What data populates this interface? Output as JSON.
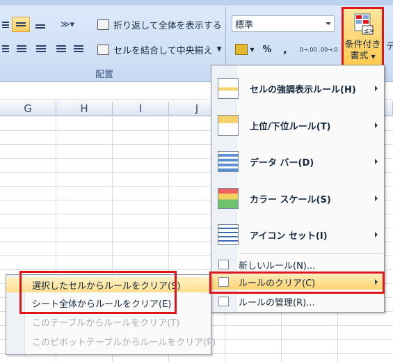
{
  "ribbon": {
    "wrap_text_label": "折り返して全体を表示する",
    "merge_center_label": "セルを結合して中央揃え",
    "group_label": "配置",
    "number_format_value": "標準",
    "percent_label": "%",
    "comma_label": ",",
    "inc_decimal_label": ".0→.00",
    "dec_decimal_label": ".00→.0",
    "conditional_format_label_line1": "条件付き",
    "conditional_format_label_line2": "書式",
    "next_button_partial": "テ"
  },
  "columns": [
    "G",
    "H",
    "I",
    "J"
  ],
  "menu": {
    "items": [
      {
        "label": "セルの強調表示ルール(H)",
        "icon": "highlight-rules-icon",
        "has_submenu": true
      },
      {
        "label": "上位/下位ルール(T)",
        "icon": "top-bottom-rules-icon",
        "has_submenu": true
      },
      {
        "label": "データ バー(D)",
        "icon": "data-bars-icon",
        "has_submenu": true
      },
      {
        "label": "カラー スケール(S)",
        "icon": "color-scales-icon",
        "has_submenu": true
      },
      {
        "label": "アイコン セット(I)",
        "icon": "icon-sets-icon",
        "has_submenu": true
      }
    ],
    "small_items": [
      {
        "label": "新しいルール(N)...",
        "icon": "new-rule-icon",
        "has_submenu": false
      },
      {
        "label": "ルールのクリア(C)",
        "icon": "clear-rules-icon",
        "has_submenu": true,
        "highlighted": true
      },
      {
        "label": "ルールの管理(R)...",
        "icon": "manage-rules-icon",
        "has_submenu": false
      }
    ]
  },
  "submenu": {
    "items": [
      {
        "label": "選択したセルからルールをクリア(S)",
        "enabled": true,
        "highlighted": true
      },
      {
        "label": "シート全体からルールをクリア(E)",
        "enabled": true,
        "highlighted": false
      },
      {
        "label": "このテーブルからルールをクリア(T)",
        "enabled": false,
        "highlighted": false
      },
      {
        "label": "このピボットテーブルからルールをクリア(P)",
        "enabled": false,
        "highlighted": false
      }
    ]
  },
  "colors": {
    "annotation_red": "#e0151b",
    "highlight_orange": "#ffd36e",
    "ribbon_blue": "#d3e2f7"
  }
}
